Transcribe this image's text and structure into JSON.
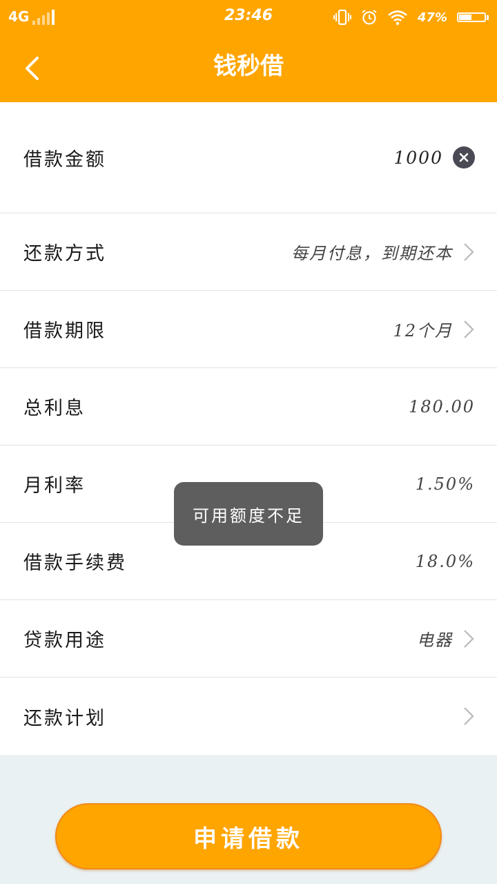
{
  "status_bar": {
    "network": "4G",
    "signal_level": 1,
    "time": "23:46",
    "battery_percent": "47%",
    "battery_level": 0.47,
    "icons": [
      "vibrate-icon",
      "alarm-icon",
      "wifi-icon",
      "battery-icon"
    ]
  },
  "header": {
    "back_icon": "chevron-left-icon",
    "title": "钱秒借"
  },
  "form": {
    "amount": {
      "label": "借款金额",
      "value": "1000"
    },
    "repay_method": {
      "label": "还款方式",
      "value": "每月付息，到期还本"
    },
    "term": {
      "label": "借款期限",
      "value": "12个月"
    },
    "total_interest": {
      "label": "总利息",
      "value": "180.00"
    },
    "monthly_rate": {
      "label": "月利率",
      "value": "1.50%"
    },
    "fee": {
      "label": "借款手续费",
      "value": "18.0%"
    },
    "purpose": {
      "label": "贷款用途",
      "value": "电器"
    },
    "plan": {
      "label": "还款计划",
      "value": ""
    }
  },
  "toast": {
    "message": "可用额度不足"
  },
  "submit": {
    "label": "申请借款"
  },
  "colors": {
    "brand": "#ffa500",
    "background": "#e9f1f2",
    "text": "#1a1a1a",
    "toast": "#505050"
  }
}
